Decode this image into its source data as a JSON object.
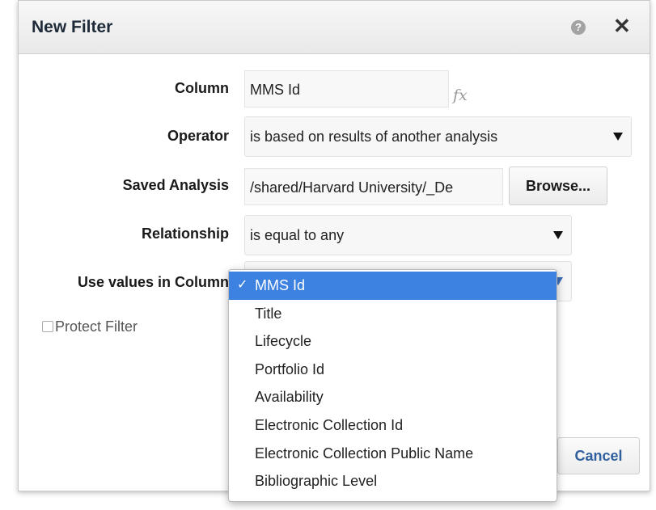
{
  "dialog": {
    "title": "New Filter",
    "help_icon": "help-icon",
    "close_icon": "close-icon",
    "close_glyph": "✕"
  },
  "form": {
    "column": {
      "label": "Column",
      "value": "MMS Id",
      "fx": "fx"
    },
    "operator": {
      "label": "Operator",
      "value": "is based on results of another analysis"
    },
    "saved_analysis": {
      "label": "Saved Analysis",
      "value": "/shared/Harvard University/_De",
      "browse_label": "Browse..."
    },
    "relationship": {
      "label": "Relationship",
      "value": "is equal to any"
    },
    "use_values": {
      "label": "Use values in Column"
    },
    "protect_filter": {
      "label": "Protect Filter",
      "checked": false
    }
  },
  "dropdown": {
    "check_glyph": "✓",
    "options": [
      {
        "label": "MMS Id",
        "selected": true
      },
      {
        "label": "Title",
        "selected": false
      },
      {
        "label": "Lifecycle",
        "selected": false
      },
      {
        "label": "Portfolio Id",
        "selected": false
      },
      {
        "label": "Availability",
        "selected": false
      },
      {
        "label": "Electronic Collection Id",
        "selected": false
      },
      {
        "label": "Electronic Collection Public Name",
        "selected": false
      },
      {
        "label": "Bibliographic Level",
        "selected": false
      }
    ]
  },
  "footer": {
    "cancel_label": "Cancel"
  },
  "colors": {
    "accent": "#3d82e0",
    "cancel_text": "#2f5f9e"
  }
}
